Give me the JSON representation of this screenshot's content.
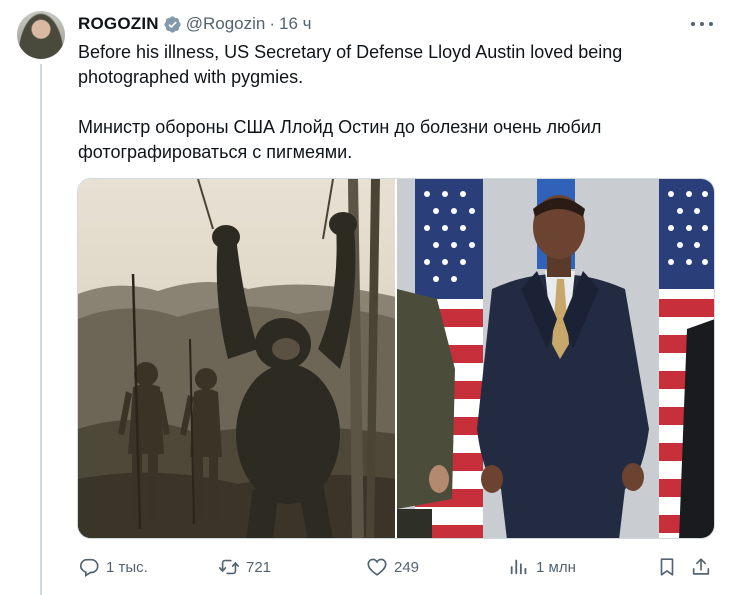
{
  "author": {
    "display_name": "ROGOZIN",
    "handle": "@Rogozin",
    "separator": "·",
    "time": "16 ч",
    "verified": true
  },
  "tweet": {
    "text_en": "Before his illness, US Secretary of Defense Lloyd Austin loved being photographed with pygmies.",
    "text_ru": "Министр обороны США Ллойд Остин до болезни очень любил фотографироваться с пигмеями."
  },
  "actions": {
    "replies": "1 тыс.",
    "reposts": "721",
    "likes": "249",
    "views": "1 млн"
  },
  "icons": {
    "verified": "verified-badge-icon",
    "more": "more-icon",
    "reply": "reply-icon",
    "repost": "repost-icon",
    "like": "heart-icon",
    "views": "views-icon",
    "bookmark": "bookmark-icon",
    "share": "share-icon"
  },
  "colors": {
    "text": "#0f1419",
    "secondary": "#536471",
    "border": "#cfd9de",
    "verified_badge": "#829aab"
  }
}
